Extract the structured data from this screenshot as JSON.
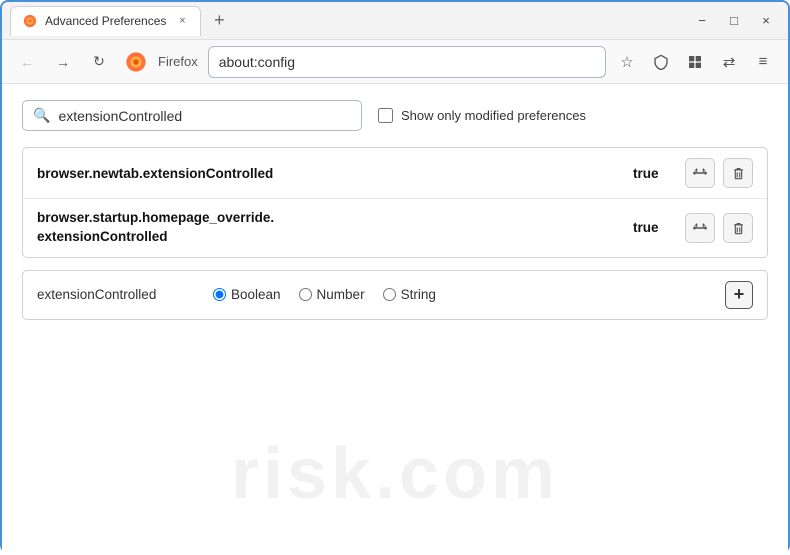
{
  "window": {
    "title": "Advanced Preferences",
    "close_label": "×",
    "minimize_label": "−",
    "maximize_label": "□",
    "new_tab_label": "+"
  },
  "toolbar": {
    "back_icon": "←",
    "forward_icon": "→",
    "refresh_icon": "↻",
    "firefox_label": "Firefox",
    "address": "about:config",
    "bookmark_icon": "☆",
    "shield_icon": "⛨",
    "extension_icon": "🧩",
    "sync_icon": "⇄",
    "menu_icon": "≡"
  },
  "search": {
    "placeholder": "extensionControlled",
    "value": "extensionControlled",
    "show_modified_label": "Show only modified preferences"
  },
  "preferences": [
    {
      "name": "browser.newtab.extensionControlled",
      "value": "true",
      "multiline": false
    },
    {
      "name_line1": "browser.startup.homepage_override.",
      "name_line2": "extensionControlled",
      "value": "true",
      "multiline": true
    }
  ],
  "add_row": {
    "name": "extensionControlled",
    "types": [
      "Boolean",
      "Number",
      "String"
    ],
    "selected_type": "Boolean",
    "add_icon": "+"
  },
  "icons": {
    "toggle_icon": "⇄",
    "delete_icon": "🗑",
    "search_icon": "🔍"
  },
  "watermark": {
    "text": "risk.com"
  }
}
